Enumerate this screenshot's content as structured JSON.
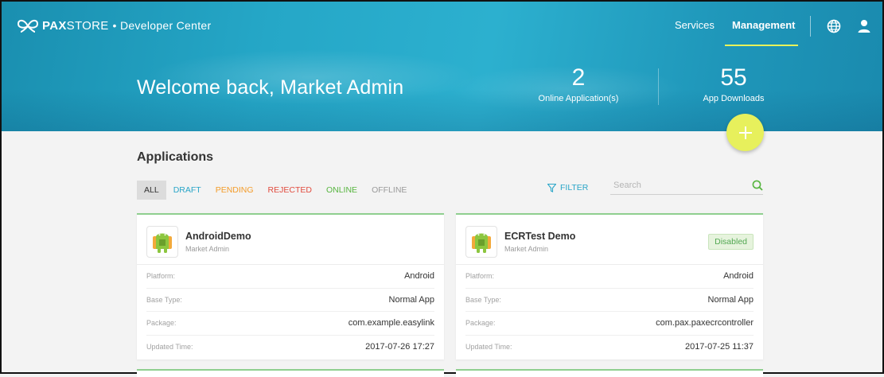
{
  "header": {
    "brand_bold": "PAX",
    "brand_light": "STORE",
    "brand_suffix": "• Developer Center",
    "nav": {
      "services": "Services",
      "management": "Management"
    },
    "icons": {
      "language": "globe-icon",
      "account": "user-icon"
    }
  },
  "hero": {
    "welcome": "Welcome back, Market Admin",
    "stats": [
      {
        "value": "2",
        "label": "Online Application(s)"
      },
      {
        "value": "55",
        "label": "App Downloads"
      }
    ],
    "add_button_icon": "plus-icon"
  },
  "applications": {
    "title": "Applications",
    "tabs": [
      "ALL",
      "DRAFT",
      "PENDING",
      "REJECTED",
      "ONLINE",
      "OFFLINE"
    ],
    "active_tab": "ALL",
    "filter_label": "FILTER",
    "search_placeholder": "Search",
    "cards": [
      {
        "name": "AndroidDemo",
        "developer": "Market Admin",
        "badge": "",
        "rows": [
          {
            "key": "Platform:",
            "value": "Android"
          },
          {
            "key": "Base Type:",
            "value": "Normal App"
          },
          {
            "key": "Package:",
            "value": "com.example.easylink"
          },
          {
            "key": "Updated Time:",
            "value": "2017-07-26 17:27"
          }
        ]
      },
      {
        "name": "ECRTest Demo",
        "developer": "Market Admin",
        "badge": "Disabled",
        "rows": [
          {
            "key": "Platform:",
            "value": "Android"
          },
          {
            "key": "Base Type:",
            "value": "Normal App"
          },
          {
            "key": "Package:",
            "value": "com.pax.paxecrcontroller"
          },
          {
            "key": "Updated Time:",
            "value": "2017-07-25 11:37"
          }
        ]
      }
    ]
  },
  "colors": {
    "hero": "#25a7c7",
    "accent_yellow": "#e7f05c",
    "draft": "#2aa6c8",
    "pending": "#f39c2a",
    "rejected": "#e24c3f",
    "online": "#57b53f",
    "offline": "#9a9a9a"
  }
}
